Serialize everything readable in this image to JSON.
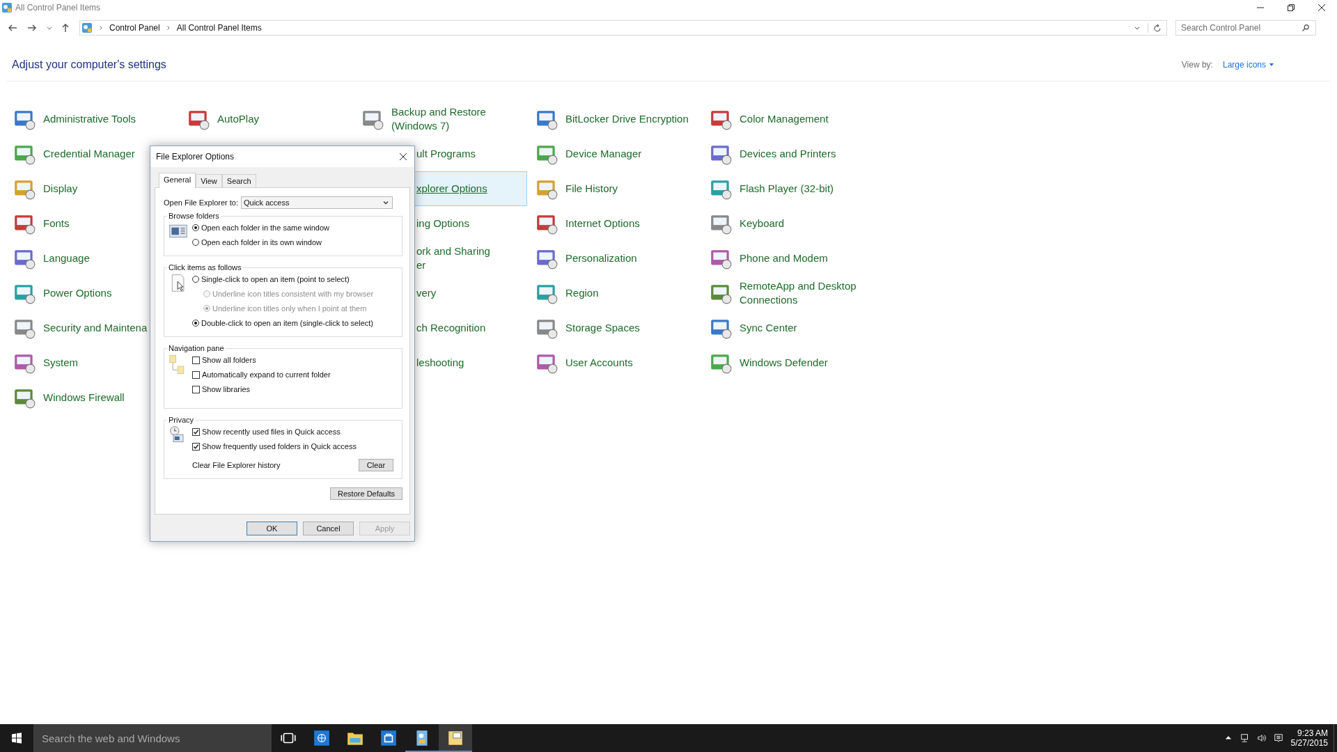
{
  "window": {
    "title": "All Control Panel Items"
  },
  "address_bar": {
    "crumbs": [
      "Control Panel",
      "All Control Panel Items"
    ],
    "search_placeholder": "Search Control Panel"
  },
  "heading": "Adjust your computer's settings",
  "view_by": {
    "label": "View by:",
    "value": "Large icons"
  },
  "columns": [
    [
      {
        "kind": "full",
        "lines": [
          "Administrative Tools"
        ],
        "selected": false
      },
      {
        "kind": "full",
        "lines": [
          "Credential Manager"
        ],
        "selected": false
      },
      {
        "kind": "full",
        "lines": [
          "Display"
        ],
        "selected": false
      },
      {
        "kind": "full",
        "lines": [
          "Fonts"
        ],
        "selected": false
      },
      {
        "kind": "full",
        "lines": [
          "Language"
        ],
        "selected": false
      },
      {
        "kind": "full",
        "lines": [
          "Power Options"
        ],
        "selected": false
      },
      {
        "kind": "full",
        "lines": [
          "Security and Maintena"
        ],
        "selected": false
      },
      {
        "kind": "full",
        "lines": [
          "System"
        ],
        "selected": false
      },
      {
        "kind": "full",
        "lines": [
          "Windows Firewall"
        ],
        "selected": false
      }
    ],
    [
      {
        "kind": "full",
        "lines": [
          "AutoPlay"
        ],
        "selected": false
      }
    ],
    [
      {
        "kind": "full",
        "lines": [
          "Backup and Restore",
          "(Windows 7)"
        ],
        "selected": false
      },
      {
        "kind": "cut",
        "lines": [
          "ult Programs"
        ],
        "selected": false
      },
      {
        "kind": "cut",
        "lines": [
          "xplorer Options"
        ],
        "selected": true
      },
      {
        "kind": "cut",
        "lines": [
          "ing Options"
        ],
        "selected": false
      },
      {
        "kind": "cut",
        "lines": [
          "ork and Sharing",
          "er"
        ],
        "selected": false
      },
      {
        "kind": "cut",
        "lines": [
          "very"
        ],
        "selected": false
      },
      {
        "kind": "cut",
        "lines": [
          "ch Recognition"
        ],
        "selected": false
      },
      {
        "kind": "cut",
        "lines": [
          "leshooting"
        ],
        "selected": false
      }
    ],
    [
      {
        "kind": "full",
        "lines": [
          "BitLocker Drive Encryption"
        ],
        "selected": false
      },
      {
        "kind": "full",
        "lines": [
          "Device Manager"
        ],
        "selected": false
      },
      {
        "kind": "full",
        "lines": [
          "File History"
        ],
        "selected": false
      },
      {
        "kind": "full",
        "lines": [
          "Internet Options"
        ],
        "selected": false
      },
      {
        "kind": "full",
        "lines": [
          "Personalization"
        ],
        "selected": false
      },
      {
        "kind": "full",
        "lines": [
          "Region"
        ],
        "selected": false
      },
      {
        "kind": "full",
        "lines": [
          "Storage Spaces"
        ],
        "selected": false
      },
      {
        "kind": "full",
        "lines": [
          "User Accounts"
        ],
        "selected": false
      }
    ],
    [
      {
        "kind": "full",
        "lines": [
          "Color Management"
        ],
        "selected": false
      },
      {
        "kind": "full",
        "lines": [
          "Devices and Printers"
        ],
        "selected": false
      },
      {
        "kind": "full",
        "lines": [
          "Flash Player (32-bit)"
        ],
        "selected": false
      },
      {
        "kind": "full",
        "lines": [
          "Keyboard"
        ],
        "selected": false
      },
      {
        "kind": "full",
        "lines": [
          "Phone and Modem"
        ],
        "selected": false
      },
      {
        "kind": "full",
        "lines": [
          "RemoteApp and Desktop",
          "Connections"
        ],
        "selected": false
      },
      {
        "kind": "full",
        "lines": [
          "Sync Center"
        ],
        "selected": false
      },
      {
        "kind": "full",
        "lines": [
          "Windows Defender"
        ],
        "selected": false
      }
    ]
  ],
  "dialog": {
    "title": "File Explorer Options",
    "tabs": [
      {
        "label": "General",
        "selected": true
      },
      {
        "label": "View",
        "selected": false
      },
      {
        "label": "Search",
        "selected": false
      }
    ],
    "open_to": {
      "label": "Open File Explorer to:",
      "value": "Quick access"
    },
    "browse_folders": {
      "title": "Browse folders",
      "options": [
        {
          "label": "Open each folder in the same window",
          "selected": true,
          "disabled": false,
          "kind": "main"
        },
        {
          "label": "Open each folder in its own window",
          "selected": false,
          "disabled": false,
          "kind": "main"
        }
      ]
    },
    "click_items": {
      "title": "Click items as follows",
      "options": [
        {
          "label": "Single-click to open an item (point to select)",
          "selected": false,
          "disabled": false,
          "kind": "main"
        },
        {
          "label": "Underline icon titles consistent with my browser",
          "selected": false,
          "disabled": true,
          "kind": "sub"
        },
        {
          "label": "Underline icon titles only when I point at them",
          "selected": true,
          "disabled": true,
          "kind": "sub"
        },
        {
          "label": "Double-click to open an item (single-click to select)",
          "selected": true,
          "disabled": false,
          "kind": "main"
        }
      ]
    },
    "navigation_pane": {
      "title": "Navigation pane",
      "options": [
        {
          "label": "Show all folders",
          "checked": false
        },
        {
          "label": "Automatically expand to current folder",
          "checked": false
        },
        {
          "label": "Show libraries",
          "checked": false
        }
      ]
    },
    "privacy": {
      "title": "Privacy",
      "options": [
        {
          "label": "Show recently used files in Quick access",
          "checked": true
        },
        {
          "label": "Show frequently used folders in Quick access",
          "checked": true
        }
      ],
      "clear_label": "Clear File Explorer history",
      "clear_button": "Clear"
    },
    "restore_button": "Restore Defaults",
    "buttons": [
      {
        "label": "OK",
        "disabled": false
      },
      {
        "label": "Cancel",
        "disabled": false
      },
      {
        "label": "Apply",
        "disabled": true
      }
    ]
  },
  "taskbar": {
    "search_placeholder": "Search the web and Windows",
    "time": "9:23 AM",
    "date": "5/27/2015"
  }
}
